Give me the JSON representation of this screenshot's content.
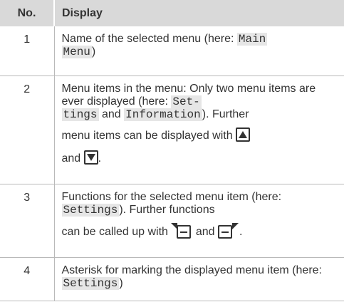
{
  "table": {
    "header": {
      "no": "No.",
      "display": "Display"
    },
    "rows": [
      {
        "no": "1",
        "t1": "Name of the selected menu (here: ",
        "m1": "Main",
        "m2": "Menu",
        "t2": ")"
      },
      {
        "no": "2",
        "t1": "Menu items in the menu: Only two menu items are ever displayed (here: ",
        "m1": "Set-",
        "m2": "tings",
        "t2": " and ",
        "m3": "Information",
        "t3": "). Further",
        "t4": "menu items can be displayed with",
        "t5": "and",
        "t6": ".",
        "icon_up": "arrow-up-key-icon",
        "icon_down": "arrow-down-key-icon"
      },
      {
        "no": "3",
        "t1": "Functions for the selected menu item (here: ",
        "m1": "Settings",
        "t2": "). Further functions",
        "t3": "can be called up with",
        "t4": "and",
        "t5": ".",
        "icon_left": "left-softkey-icon",
        "icon_right": "right-softkey-icon"
      },
      {
        "no": "4",
        "t1": "Asterisk for marking the displayed menu item (here: ",
        "m1": "Settings",
        "t2": ")"
      }
    ]
  }
}
